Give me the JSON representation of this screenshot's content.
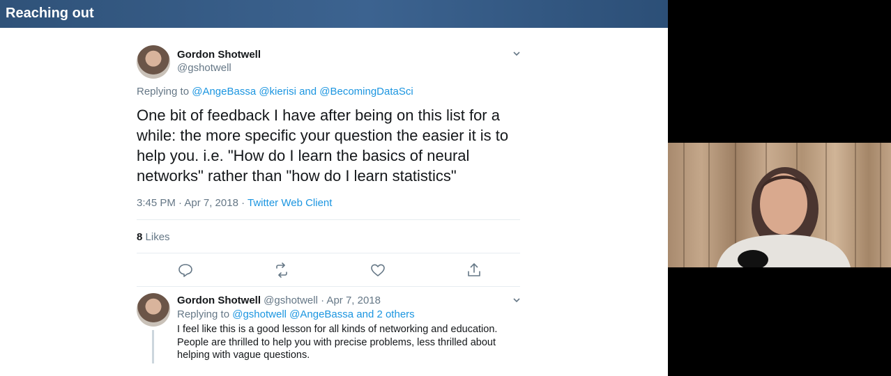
{
  "slide": {
    "title": "Reaching out"
  },
  "tweet": {
    "author_name": "Gordon Shotwell",
    "author_handle": "@gshotwell",
    "replying_to_prefix": "Replying to",
    "replying_to_links": "@AngeBassa @kierisi and @BecomingDataSci",
    "body": "One bit of feedback I have after being on this list for a while: the more specific your question the easier it is to help you. i.e. \"How do I learn the basics of neural networks\" rather than \"how do I learn statistics\"",
    "timestamp": "3:45 PM · Apr 7, 2018 ·",
    "client": "Twitter Web Client",
    "likes_count": "8",
    "likes_label": "Likes",
    "actions": [
      "reply-icon",
      "retweet-icon",
      "like-icon",
      "share-icon"
    ]
  },
  "reply_tweet": {
    "author_name": "Gordon Shotwell",
    "author_handle_date": "@gshotwell · Apr 7, 2018",
    "replying_to_prefix": "Replying to",
    "replying_to_links": "@gshotwell @AngeBassa and 2 others",
    "body": "I feel like this is a good lesson for all kinds of networking and education. People are thrilled to help you with precise problems, less thrilled about helping with vague questions."
  },
  "colors": {
    "link": "#1b95e0",
    "header": "#3a5f8a",
    "text": "#14171a",
    "muted": "#657786"
  }
}
